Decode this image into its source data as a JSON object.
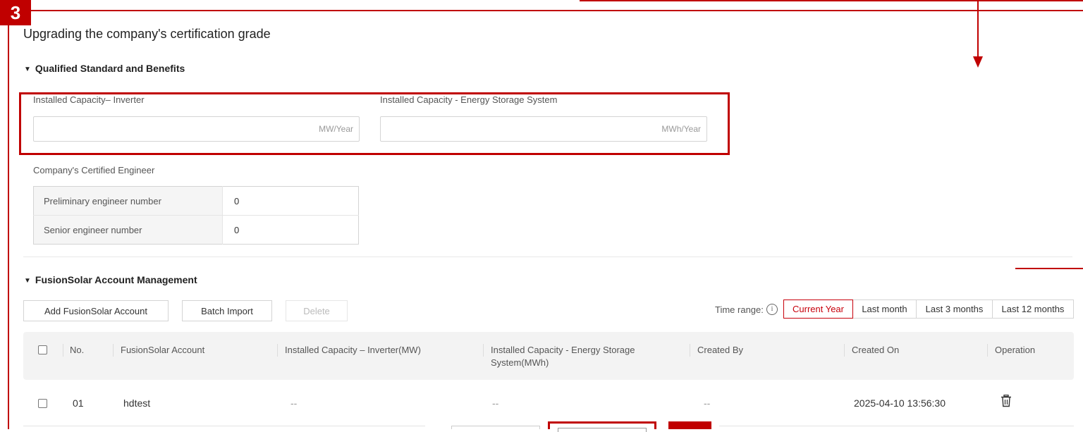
{
  "step_badge": "3",
  "page_title": "Upgrading the company's certification grade",
  "qualified": {
    "section_title": "Qualified Standard and Benefits",
    "inverter_label": "Installed Capacity– Inverter",
    "inverter_unit": "MW/Year",
    "ess_label": "Installed Capacity - Energy Storage System",
    "ess_unit": "MWh/Year",
    "engineer_label": "Company's Certified Engineer",
    "engineers": [
      {
        "key": "Preliminary engineer number",
        "value": "0"
      },
      {
        "key": "Senior engineer number",
        "value": "0"
      }
    ]
  },
  "account": {
    "section_title": "FusionSolar Account Management",
    "add_button": "Add FusionSolar Account",
    "import_button": "Batch Import",
    "delete_button": "Delete",
    "time_range_label": "Time range:",
    "time_ranges": [
      "Current Year",
      "Last month",
      "Last 3 months",
      "Last 12 months"
    ],
    "active_range": "Current Year",
    "columns": [
      "No.",
      "FusionSolar Account",
      "Installed Capacity – Inverter(MW)",
      "Installed Capacity - Energy Storage System(MWh)",
      "Created By",
      "Created On",
      "Operation"
    ],
    "rows": [
      {
        "no": "01",
        "account": "hdtest",
        "inverter": "--",
        "ess": "--",
        "created_by": "--",
        "created_on": "2025-04-10 13:56:30"
      }
    ]
  },
  "colors": {
    "annotation_red": "#c00000",
    "accent": "#c7000b"
  }
}
